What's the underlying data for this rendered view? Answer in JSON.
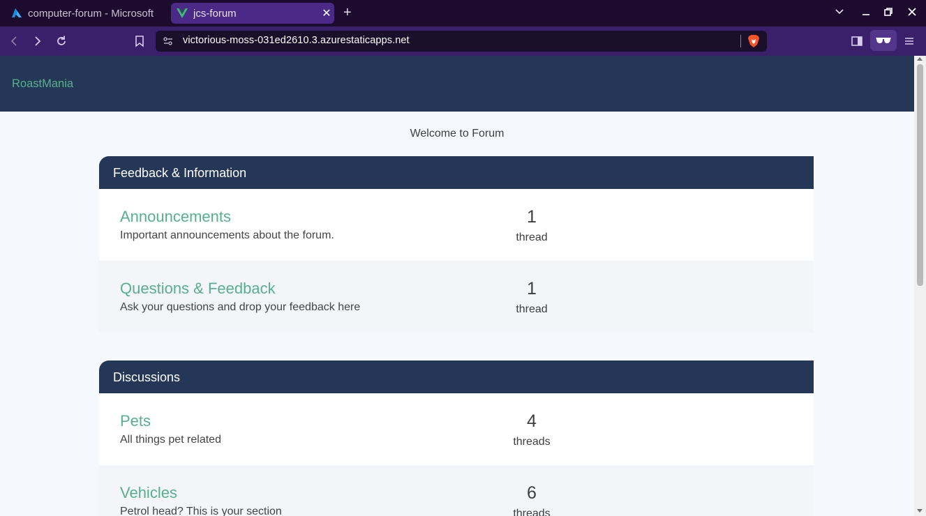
{
  "browser": {
    "tabs": [
      {
        "title": "computer-forum - Microsoft",
        "active": false,
        "icon": "azure-icon"
      },
      {
        "title": "jcs-forum",
        "active": true,
        "icon": "vue-icon"
      }
    ],
    "url": "victorious-moss-031ed2610.3.azurestaticapps.net",
    "controls": {
      "new_tab": "+",
      "tab_list": "⌄",
      "minimize": "—",
      "restore": "❐",
      "close": "✕"
    }
  },
  "site": {
    "brand": "RoastMania",
    "welcome": "Welcome to Forum"
  },
  "categories": [
    {
      "title": "Feedback & Information",
      "forums": [
        {
          "name": "Announcements",
          "description": "Important announcements about the forum.",
          "count": "1",
          "count_label": "thread"
        },
        {
          "name": "Questions & Feedback",
          "description": "Ask your questions and drop your feedback here",
          "count": "1",
          "count_label": "thread"
        }
      ]
    },
    {
      "title": "Discussions",
      "forums": [
        {
          "name": "Pets",
          "description": "All things pet related",
          "count": "4",
          "count_label": "threads"
        },
        {
          "name": "Vehicles",
          "description": "Petrol head? This is your section",
          "count": "6",
          "count_label": "threads"
        }
      ]
    }
  ],
  "colors": {
    "header_bg": "#253756",
    "accent_green": "#57b08d",
    "tabbar_bg": "#1d0b2d",
    "toolbar_bg": "#3a1f6b"
  }
}
